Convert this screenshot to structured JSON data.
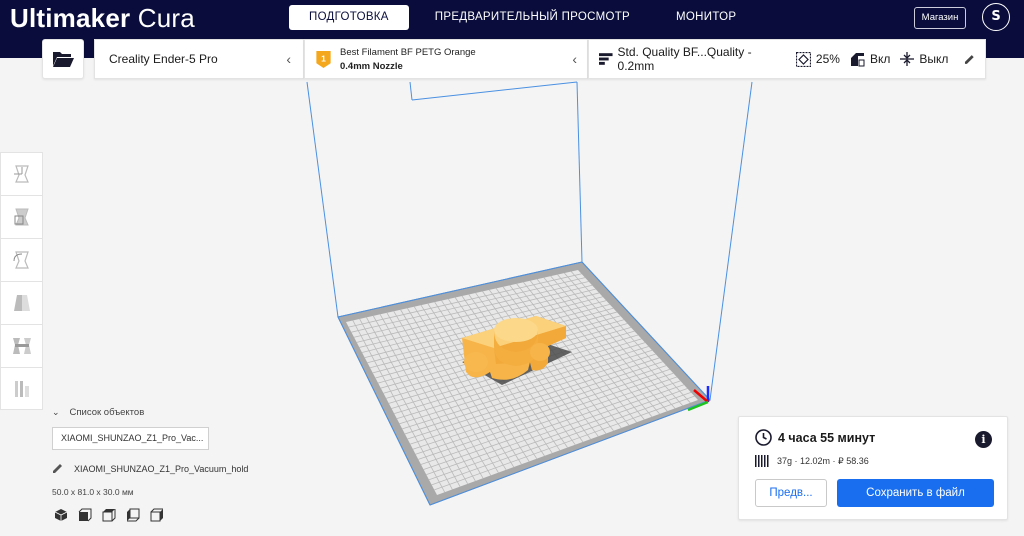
{
  "app": {
    "brand_bold": "Ultimaker",
    "brand_light": "Cura"
  },
  "header": {
    "tabs": [
      {
        "label": "ПОДГОТОВКА",
        "active": true
      },
      {
        "label": "ПРЕДВАРИТЕЛЬНЫЙ ПРОСМОТР",
        "active": false
      },
      {
        "label": "МОНИТОР",
        "active": false
      }
    ],
    "shop_label": "Магазин",
    "avatar_initial": "S"
  },
  "toolbar": {
    "printer_name": "Creality Ender-5 Pro",
    "material": {
      "extruder_number": "1",
      "name": "Best Filament BF PETG Orange",
      "nozzle": "0.4mm Nozzle"
    },
    "settings": {
      "profile": "Std. Quality BF...Quality - 0.2mm",
      "infill": "25%",
      "support": "Вкл",
      "adhesion": "Выкл"
    }
  },
  "object_list": {
    "header": "Список объектов",
    "entry": "XIAOMI_SHUNZAO_Z1_Pro_Vac...",
    "active_name": "XIAOMI_SHUNZAO_Z1_Pro_Vacuum_hold",
    "dimensions": "50.0 x 81.0 x 30.0 мм"
  },
  "output": {
    "print_time": "4 часа 55 минут",
    "stats": "37g · 12.02m · ₽ 58.36",
    "preview_label": "Предв...",
    "save_label": "Сохранить в файл"
  },
  "colors": {
    "header_bg": "#0a0d3b",
    "accent_blue": "#196ef0",
    "model_orange": "#f8b84e",
    "badge_orange": "#f4a71c"
  }
}
